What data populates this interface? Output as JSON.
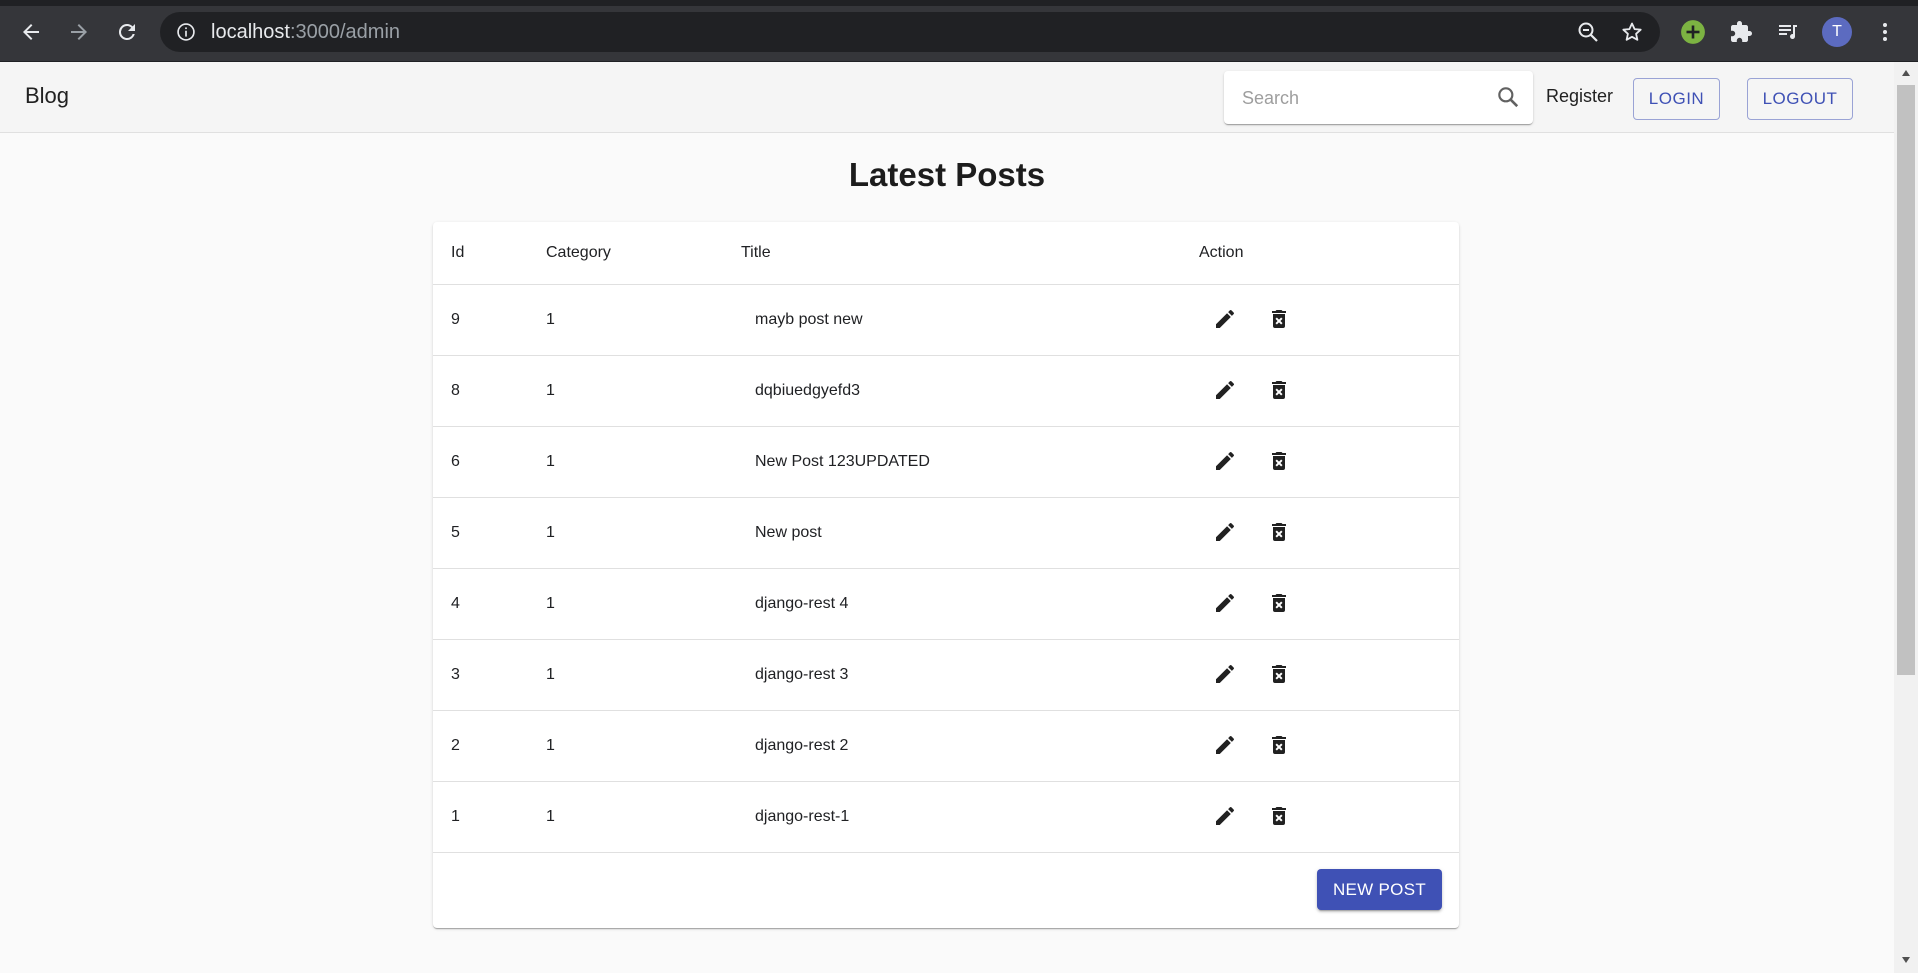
{
  "browser": {
    "url_host": "localhost",
    "url_path": ":3000/admin",
    "avatar_letter": "T"
  },
  "appbar": {
    "brand": "Blog",
    "search_placeholder": "Search",
    "register_label": "Register",
    "login_label": "LOGIN",
    "logout_label": "LOGOUT"
  },
  "main": {
    "title": "Latest Posts",
    "columns": {
      "id": "Id",
      "category": "Category",
      "title": "Title",
      "action": "Action"
    },
    "rows": [
      {
        "id": "9",
        "category": "1",
        "title": "mayb post new"
      },
      {
        "id": "8",
        "category": "1",
        "title": "dqbiuedgyefd3"
      },
      {
        "id": "6",
        "category": "1",
        "title": "New Post 123UPDATED"
      },
      {
        "id": "5",
        "category": "1",
        "title": "New post"
      },
      {
        "id": "4",
        "category": "1",
        "title": "django-rest 4"
      },
      {
        "id": "3",
        "category": "1",
        "title": "django-rest 3"
      },
      {
        "id": "2",
        "category": "1",
        "title": "django-rest 2"
      },
      {
        "id": "1",
        "category": "1",
        "title": "django-rest-1"
      }
    ],
    "new_post_label": "NEW POST"
  },
  "colors": {
    "primary": "#3f51b5",
    "chrome_bg": "#35363a",
    "avatar": "#5c6bc0",
    "extension_green": "#7cb342"
  },
  "icons": [
    "back-arrow-icon",
    "forward-arrow-icon",
    "reload-icon",
    "info-icon",
    "zoom-out-icon",
    "star-icon",
    "extension-add-icon",
    "puzzle-icon",
    "media-queue-icon",
    "more-vert-icon",
    "search-icon",
    "edit-icon",
    "delete-forever-icon"
  ]
}
